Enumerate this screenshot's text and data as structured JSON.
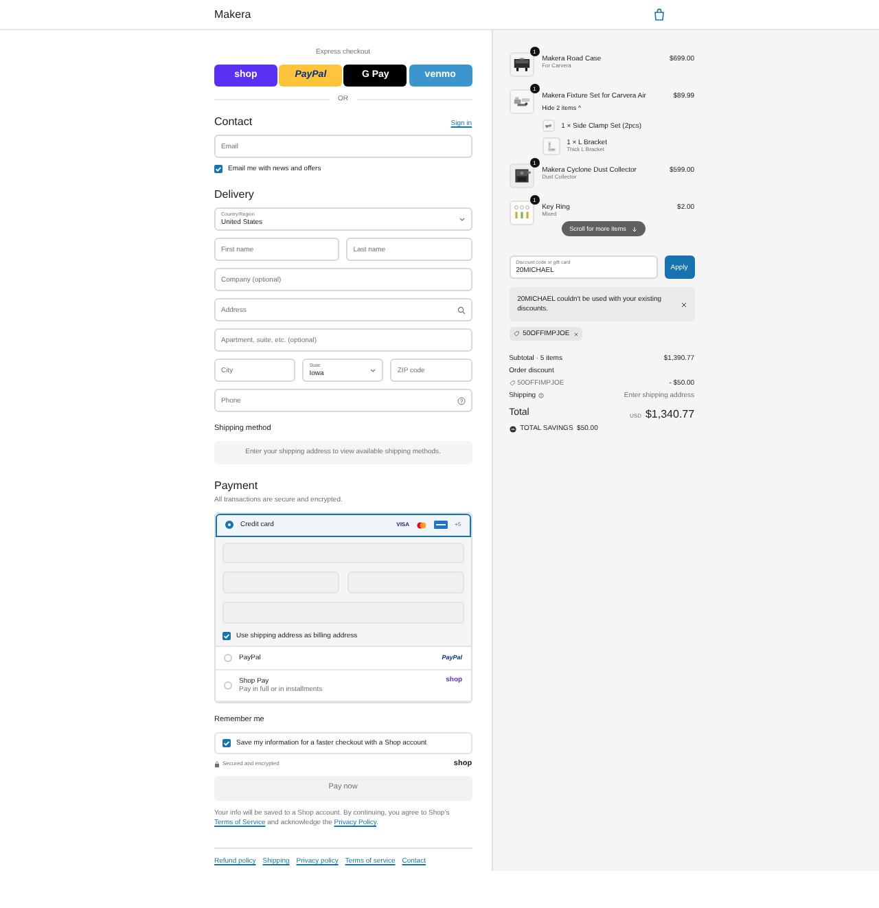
{
  "header": {
    "brand": "Makera"
  },
  "express": {
    "label": "Express checkout",
    "buttons": [
      {
        "kind": "shop",
        "label": "shop"
      },
      {
        "kind": "paypal",
        "label": "PayPal"
      },
      {
        "kind": "gpay",
        "label": "G Pay"
      },
      {
        "kind": "venmo",
        "label": "venmo"
      }
    ],
    "divider": "OR"
  },
  "contact": {
    "heading": "Contact",
    "sign_in": "Sign in",
    "email_placeholder": "Email",
    "newsletter": {
      "label": "Email me with news and offers",
      "checked": true
    }
  },
  "delivery": {
    "heading": "Delivery",
    "rows": [
      [
        {
          "kind": "select",
          "label": "Country/Region",
          "value": "United States"
        }
      ],
      [
        {
          "kind": "input",
          "placeholder": "First name"
        },
        {
          "kind": "input",
          "placeholder": "Last name"
        }
      ],
      [
        {
          "kind": "input",
          "placeholder": "Company (optional)"
        }
      ],
      [
        {
          "kind": "search",
          "placeholder": "Address"
        }
      ],
      [
        {
          "kind": "input",
          "placeholder": "Apartment, suite, etc. (optional)"
        }
      ],
      [
        {
          "kind": "input",
          "placeholder": "City"
        },
        {
          "kind": "select",
          "label": "State",
          "value": "Iowa"
        },
        {
          "kind": "input",
          "placeholder": "ZIP code"
        }
      ],
      [
        {
          "kind": "phone",
          "placeholder": "Phone"
        }
      ]
    ]
  },
  "shipping": {
    "heading": "Shipping method",
    "note": "Enter your shipping address to view available shipping methods."
  },
  "payment": {
    "heading": "Payment",
    "subtitle": "All transactions are secure and encrypted.",
    "methods": [
      {
        "kind": "card",
        "label": "Credit card",
        "selected": true,
        "brand_text": "VISA",
        "more": "+5",
        "billing": {
          "label": "Use shipping address as billing address",
          "checked": true
        }
      },
      {
        "kind": "paypal",
        "label": "PayPal",
        "selected": false,
        "logo": "PayPal"
      },
      {
        "kind": "shop",
        "label": "Shop Pay",
        "note": "Pay in full or in installments",
        "selected": false,
        "logo": "shop"
      }
    ]
  },
  "remember": {
    "heading": "Remember me",
    "save": {
      "label": "Save my information for a faster checkout with a Shop account",
      "checked": true
    },
    "secure": "Secured and encrypted",
    "logo": "shop"
  },
  "pay_button": {
    "label": "Pay now",
    "disabled": true
  },
  "legal": [
    {
      "text": "Your info will be saved to a Shop account. By continuing, you agree to Shop’s "
    },
    {
      "link": "Terms of Service"
    },
    {
      "text": " and acknowledge the "
    },
    {
      "link": "Privacy Policy"
    },
    {
      "text": "."
    }
  ],
  "footer_links": [
    "Refund policy",
    "Shipping",
    "Privacy policy",
    "Terms of service",
    "Contact"
  ],
  "summary": {
    "items": [
      {
        "name": "Makera Road Case",
        "variant": "For Carvera",
        "price": "$699.00",
        "quantity": "1"
      },
      {
        "name": "Makera Fixture Set for Carvera Air",
        "toggle": "Hide 2 items ^",
        "price": "$89.99",
        "quantity": "1",
        "sub_items": [
          {
            "name": "1 × Side Clamp Set (2pcs)"
          },
          {
            "name": "1 × L Bracket",
            "variant": "Thick L Bracket"
          }
        ]
      },
      {
        "name": "Makera Cyclone Dust Collector",
        "variant": "Dust Collector",
        "price": "$599.00",
        "quantity": "1"
      },
      {
        "name": "Key Ring",
        "variant": "Mixed",
        "price": "$2.00",
        "quantity": "1"
      }
    ],
    "scroll_hint": "Scroll for more items",
    "discount": {
      "label": "Discount code or gift card",
      "value": "20MICHAEL",
      "button": "Apply"
    },
    "error": "20MICHAEL couldn't be used with your existing discounts.",
    "tags": [
      "50OFFIMPJOE"
    ],
    "subtotal": {
      "label": "Subtotal · 5 items",
      "value": "$1,390.77"
    },
    "order_discount": {
      "label": "Order discount",
      "code": "50OFFIMPJOE",
      "value": "- $50.00"
    },
    "shipping": {
      "label": "Shipping",
      "value": "Enter shipping address"
    },
    "total": {
      "label": "Total",
      "currency": "USD",
      "value": "$1,340.77"
    },
    "savings": "TOTAL SAVINGS  $50.00"
  }
}
